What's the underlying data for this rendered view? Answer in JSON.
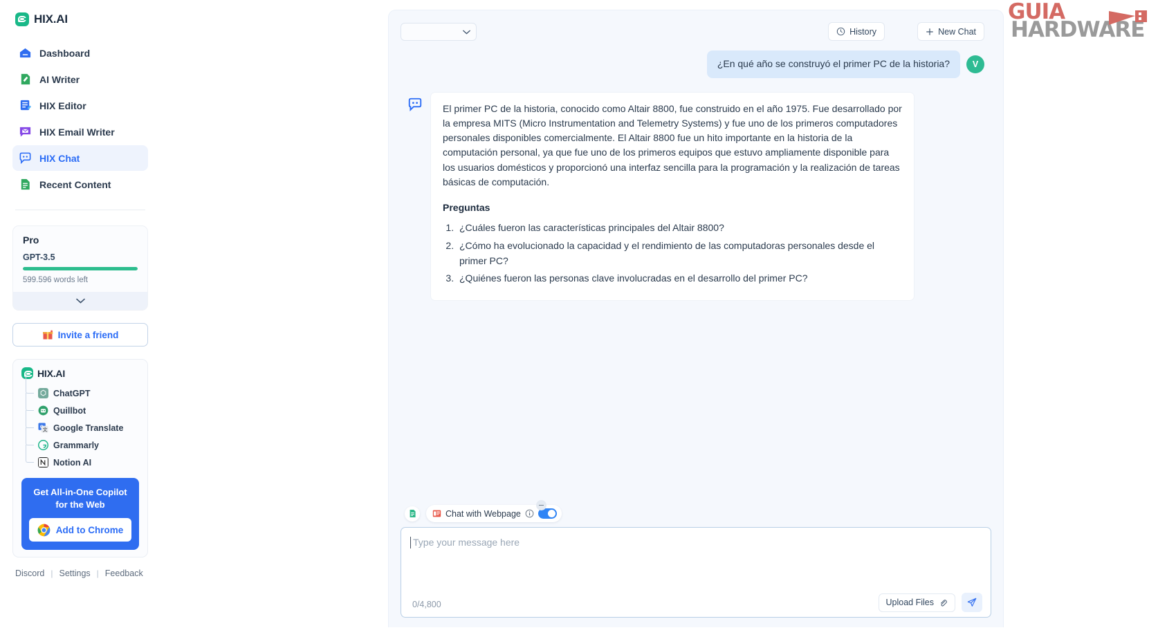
{
  "sidebar": {
    "brand": "HIX.AI",
    "nav": [
      {
        "label": "Dashboard",
        "icon": "dashboard-icon",
        "active": false
      },
      {
        "label": "AI Writer",
        "icon": "ai-writer-icon",
        "active": false
      },
      {
        "label": "HIX Editor",
        "icon": "hix-editor-icon",
        "active": false
      },
      {
        "label": "HIX Email Writer",
        "icon": "hix-email-writer-icon",
        "active": false
      },
      {
        "label": "HIX Chat",
        "icon": "hix-chat-icon",
        "active": true
      },
      {
        "label": "Recent Content",
        "icon": "recent-content-icon",
        "active": false
      }
    ],
    "plan": {
      "title": "Pro",
      "model": "GPT-3.5",
      "words_left": "599.596 words left",
      "progress_percent": 100,
      "bar_color": "#2dbd8e",
      "expand_icon": "chevron-down-icon"
    },
    "invite": {
      "label": "Invite a friend",
      "icon": "gift-icon"
    },
    "extensions": {
      "brand": "HIX.AI",
      "items": [
        {
          "label": "ChatGPT",
          "icon": "chatgpt-icon",
          "color": "#74aa9c"
        },
        {
          "label": "Quillbot",
          "icon": "quillbot-icon",
          "color": "#2fa06b"
        },
        {
          "label": "Google Translate",
          "icon": "google-translate-icon",
          "color": "#3b77e8"
        },
        {
          "label": "Grammarly",
          "icon": "grammarly-icon",
          "color": "#1eb589"
        },
        {
          "label": "Notion AI",
          "icon": "notion-ai-icon",
          "color": "#f4f4f2"
        }
      ]
    },
    "promo": {
      "text": "Get All-in-One Copilot for the Web",
      "button": "Add to Chrome",
      "button_icon": "chrome-icon",
      "background": "#2f6df0"
    },
    "footer": [
      {
        "label": "Discord"
      },
      {
        "label": "Settings"
      },
      {
        "label": "Feedback"
      }
    ],
    "footer_separator": "|"
  },
  "chat": {
    "model_selector": {
      "value": "",
      "icon": "chevron-down-icon"
    },
    "history_button": {
      "label": "History",
      "icon": "clock-history-icon"
    },
    "new_chat_button": {
      "label": "New Chat",
      "icon": "plus-icon"
    },
    "messages": [
      {
        "role": "user",
        "text": "¿En qué año se construyó el primer PC de la historia?",
        "avatar_initial": "V",
        "avatar_color": "#2ebb93",
        "bubble_color": "#d9e9fb"
      },
      {
        "role": "assistant",
        "icon": "hix-chat-icon",
        "paragraph": "El primer PC de la historia, conocido como Altair 8800, fue construido en el año 1975. Fue desarrollado por la empresa MITS (Micro Instrumentation and Telemetry Systems) y fue uno de los primeros computadores personales disponibles comercialmente. El Altair 8800 fue un hito importante en la historia de la computación personal, ya que fue uno de los primeros equipos que estuvo ampliamente disponible para los usuarios domésticos y proporcionó una interfaz sencilla para la programación y la realización de tareas básicas de computación.",
        "questions_heading": "Preguntas",
        "questions": [
          "¿Cuáles fueron las características principales del Altair 8800?",
          "¿Cómo ha evolucionado la capacidad y el rendimiento de las computadoras personales desde el primer PC?",
          "¿Quiénes fueron las personas clave involucradas en el desarrollo del primer PC?"
        ]
      }
    ],
    "composer": {
      "doc_chip_icon": "document-icon",
      "webpage_chip": {
        "label": "Chat with Webpage",
        "icon": "webpage-icon",
        "info_icon": "info-circle-icon",
        "toggle_on": true,
        "toggle_color": "#2f84f5",
        "minimize_icon": "minus-icon"
      },
      "placeholder": "Type your message here",
      "value": "",
      "counter": "0/4,800",
      "upload_button": {
        "label": "Upload Files",
        "icon": "paperclip-icon"
      },
      "send_button": {
        "icon": "send-plane-icon"
      }
    }
  },
  "watermark": {
    "line1": "GUIA",
    "line2": "HARDWARE",
    "color1": "#d46a63",
    "color2": "#9a9a9a"
  }
}
